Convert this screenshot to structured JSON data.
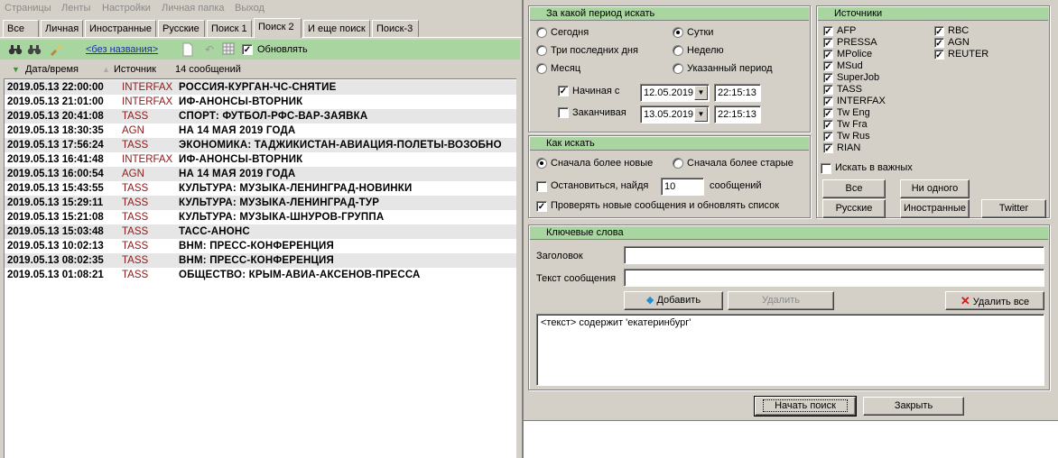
{
  "menu": [
    "Страницы",
    "Ленты",
    "Настройки",
    "Личная папка",
    "Выход"
  ],
  "tabs": [
    "Все",
    "Личная",
    "Иностранные",
    "Русские",
    "Поиск 1",
    "Поиск 2",
    "И еще поиск",
    "Поиск-3"
  ],
  "active_tab": "Поиск 2",
  "toolbar": {
    "name_link": "<без названия>",
    "refresh_label": "Обновлять",
    "refresh_checked": true
  },
  "columns": {
    "date": "Дата/время",
    "source": "Источник",
    "count": "14 сообщений"
  },
  "news": [
    {
      "dt": "2019.05.13  22:00:00",
      "src": "INTERFAX",
      "hl": "РОССИЯ-КУРГАН-ЧС-СНЯТИЕ"
    },
    {
      "dt": "2019.05.13  21:01:00",
      "src": "INTERFAX",
      "hl": "ИФ-АНОНСЫ-ВТОРНИК"
    },
    {
      "dt": "2019.05.13  20:41:08",
      "src": "TASS",
      "hl": "СПОРТ: ФУТБОЛ-РФС-ВАР-ЗАЯВКА"
    },
    {
      "dt": "2019.05.13  18:30:35",
      "src": "AGN",
      "hl": "НА 14 МАЯ  2019  ГОДА"
    },
    {
      "dt": "2019.05.13  17:56:24",
      "src": "TASS",
      "hl": "ЭКОНОМИКА: ТАДЖИКИСТАН-АВИАЦИЯ-ПОЛЕТЫ-ВОЗОБНО"
    },
    {
      "dt": "2019.05.13  16:41:48",
      "src": "INTERFAX",
      "hl": "ИФ-АНОНСЫ-ВТОРНИК"
    },
    {
      "dt": "2019.05.13  16:00:54",
      "src": "AGN",
      "hl": "НА 14 МАЯ  2019  ГОДА"
    },
    {
      "dt": "2019.05.13  15:43:55",
      "src": "TASS",
      "hl": "КУЛЬТУРА: МУЗЫКА-ЛЕНИНГРАД-НОВИНКИ"
    },
    {
      "dt": "2019.05.13  15:29:11",
      "src": "TASS",
      "hl": "КУЛЬТУРА: МУЗЫКА-ЛЕНИНГРАД-ТУР"
    },
    {
      "dt": "2019.05.13  15:21:08",
      "src": "TASS",
      "hl": "КУЛЬТУРА: МУЗЫКА-ШНУРОВ-ГРУППА"
    },
    {
      "dt": "2019.05.13  15:03:48",
      "src": "TASS",
      "hl": "ТАСС-АНОНС"
    },
    {
      "dt": "2019.05.13  10:02:13",
      "src": "TASS",
      "hl": "ВНМ: ПРЕСС-КОНФЕРЕНЦИЯ"
    },
    {
      "dt": "2019.05.13  08:02:35",
      "src": "TASS",
      "hl": "ВНМ: ПРЕСС-КОНФЕРЕНЦИЯ"
    },
    {
      "dt": "2019.05.13  01:08:21",
      "src": "TASS",
      "hl": "ОБЩЕСТВО: КРЫМ-АВИА-АКСЕНОВ-ПРЕССА"
    }
  ],
  "period": {
    "title": "За какой период искать",
    "options": [
      "Сегодня",
      "Сутки",
      "Три последних дня",
      "Неделю",
      "Месяц",
      "Указанный период"
    ],
    "selected": "Сутки",
    "start_label": "Начиная с",
    "start_checked": true,
    "start_date": "12.05.2019",
    "start_time": "22:15:13",
    "end_label": "Заканчивая",
    "end_checked": false,
    "end_date": "13.05.2019",
    "end_time": "22:15:13"
  },
  "how": {
    "title": "Как искать",
    "newer": "Сначала более новые",
    "older": "Сначала более старые",
    "selected": "Сначала более новые",
    "stop_label": "Остановиться, найдя",
    "stop_value": "10",
    "stop_suffix": "сообщений",
    "stop_checked": false,
    "check_label": "Проверять новые сообщения и обновлять список",
    "check_checked": true
  },
  "sources": {
    "title": "Источники",
    "col1": [
      "AFP",
      "PRESSA",
      "MPolice",
      "MSud",
      "SuperJob",
      "TASS",
      "INTERFAX",
      "Tw Eng",
      "Tw Fra",
      "Tw Rus",
      "RIAN"
    ],
    "col2": [
      "RBC",
      "AGN",
      "REUTER"
    ],
    "important_label": "Искать в важных",
    "important_checked": false,
    "buttons": {
      "all": "Все",
      "none": "Ни одного",
      "russian": "Русские",
      "foreign": "Иностранные",
      "twitter": "Twitter"
    }
  },
  "keywords": {
    "title": "Ключевые слова",
    "header_label": "Заголовок",
    "header_value": "",
    "text_label": "Текст сообщения",
    "text_value": "",
    "add": "Добавить",
    "remove": "Удалить",
    "remove_all": "Удалить все",
    "list": [
      "<текст> содержит 'екатеринбург'"
    ]
  },
  "actions": {
    "start": "Начать поиск",
    "close": "Закрыть"
  }
}
